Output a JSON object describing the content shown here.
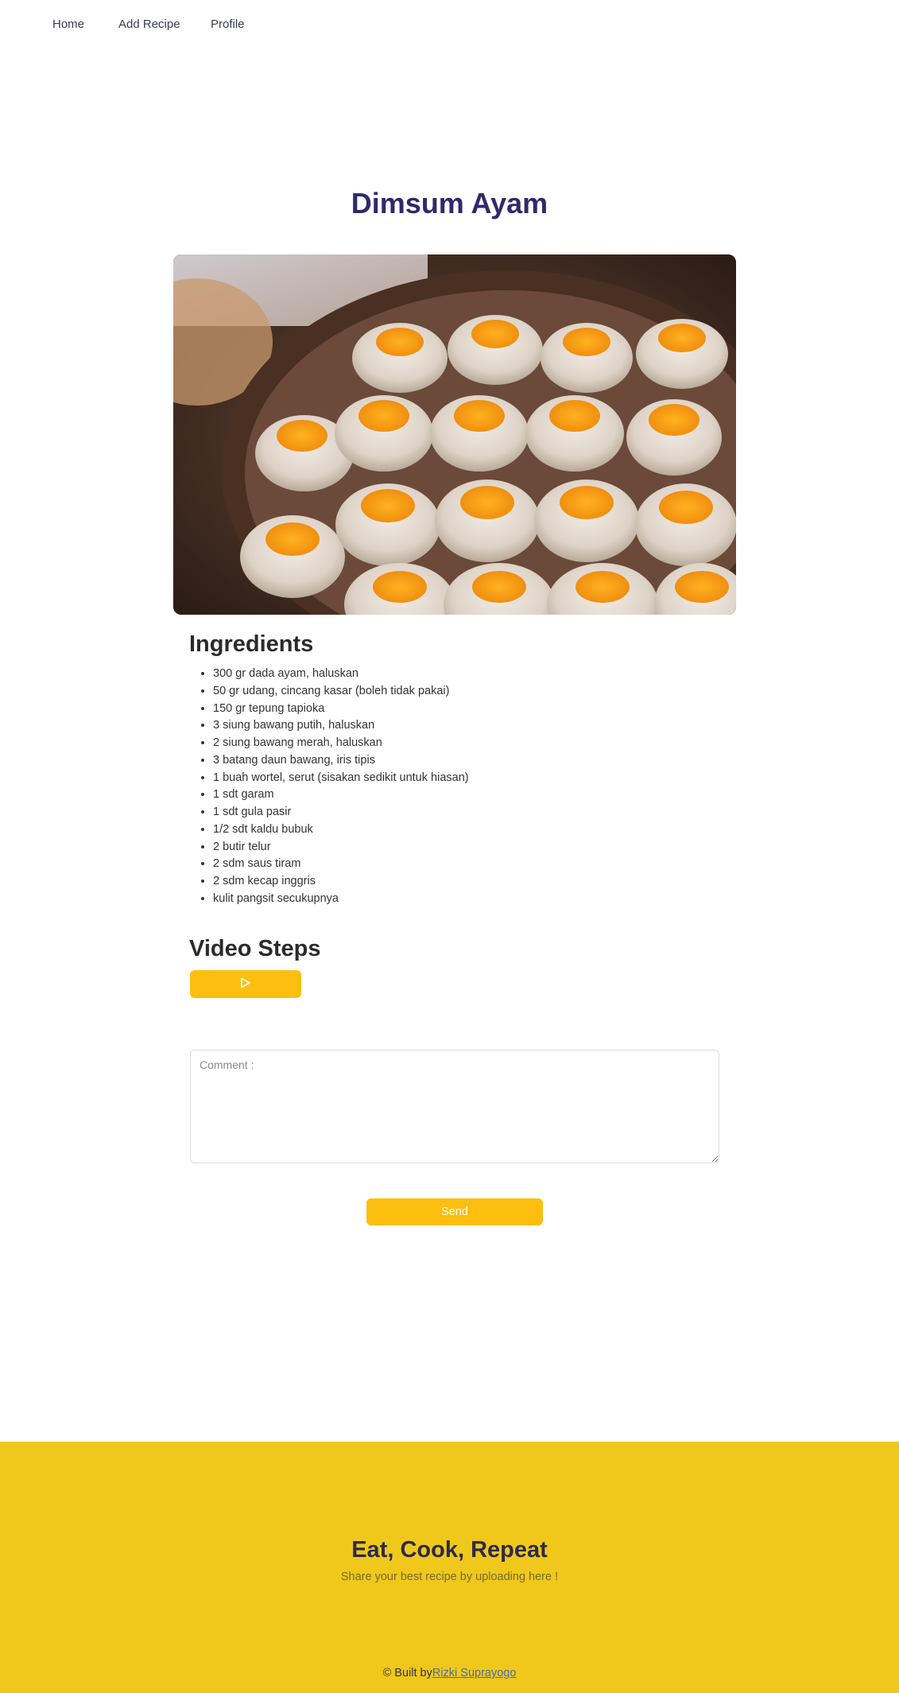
{
  "nav": {
    "items": [
      {
        "label": "Home"
      },
      {
        "label": "Add Recipe"
      },
      {
        "label": "Profile"
      }
    ]
  },
  "recipe": {
    "title": "Dimsum Ayam"
  },
  "ingredients": {
    "heading": "Ingredients",
    "items": [
      "300 gr dada ayam, haluskan",
      "50 gr udang, cincang kasar (boleh tidak pakai)",
      "150 gr tepung tapioka",
      "3 siung bawang putih, haluskan",
      "2 siung bawang merah, haluskan",
      "3 batang daun bawang, iris tipis",
      "1 buah wortel, serut (sisakan sedikit untuk hiasan)",
      "1 sdt garam",
      "1 sdt gula pasir",
      "1/2 sdt kaldu bubuk",
      "2 butir telur",
      "2 sdm saus tiram",
      "2 sdm kecap inggris",
      "kulit pangsit secukupnya"
    ]
  },
  "video": {
    "heading": "Video Steps",
    "play_icon": "play-icon"
  },
  "comment": {
    "placeholder": "Comment :",
    "value": ""
  },
  "send": {
    "label": "Send"
  },
  "footer": {
    "title": "Eat, Cook, Repeat",
    "subtitle": "Share your best recipe by uploading here !",
    "credit_prefix": "© Built by",
    "credit_link": "Rizki Suprayogo"
  },
  "colors": {
    "accent": "#fcbf10",
    "footer_bg": "#efc81b",
    "title": "#2e2a6b"
  }
}
